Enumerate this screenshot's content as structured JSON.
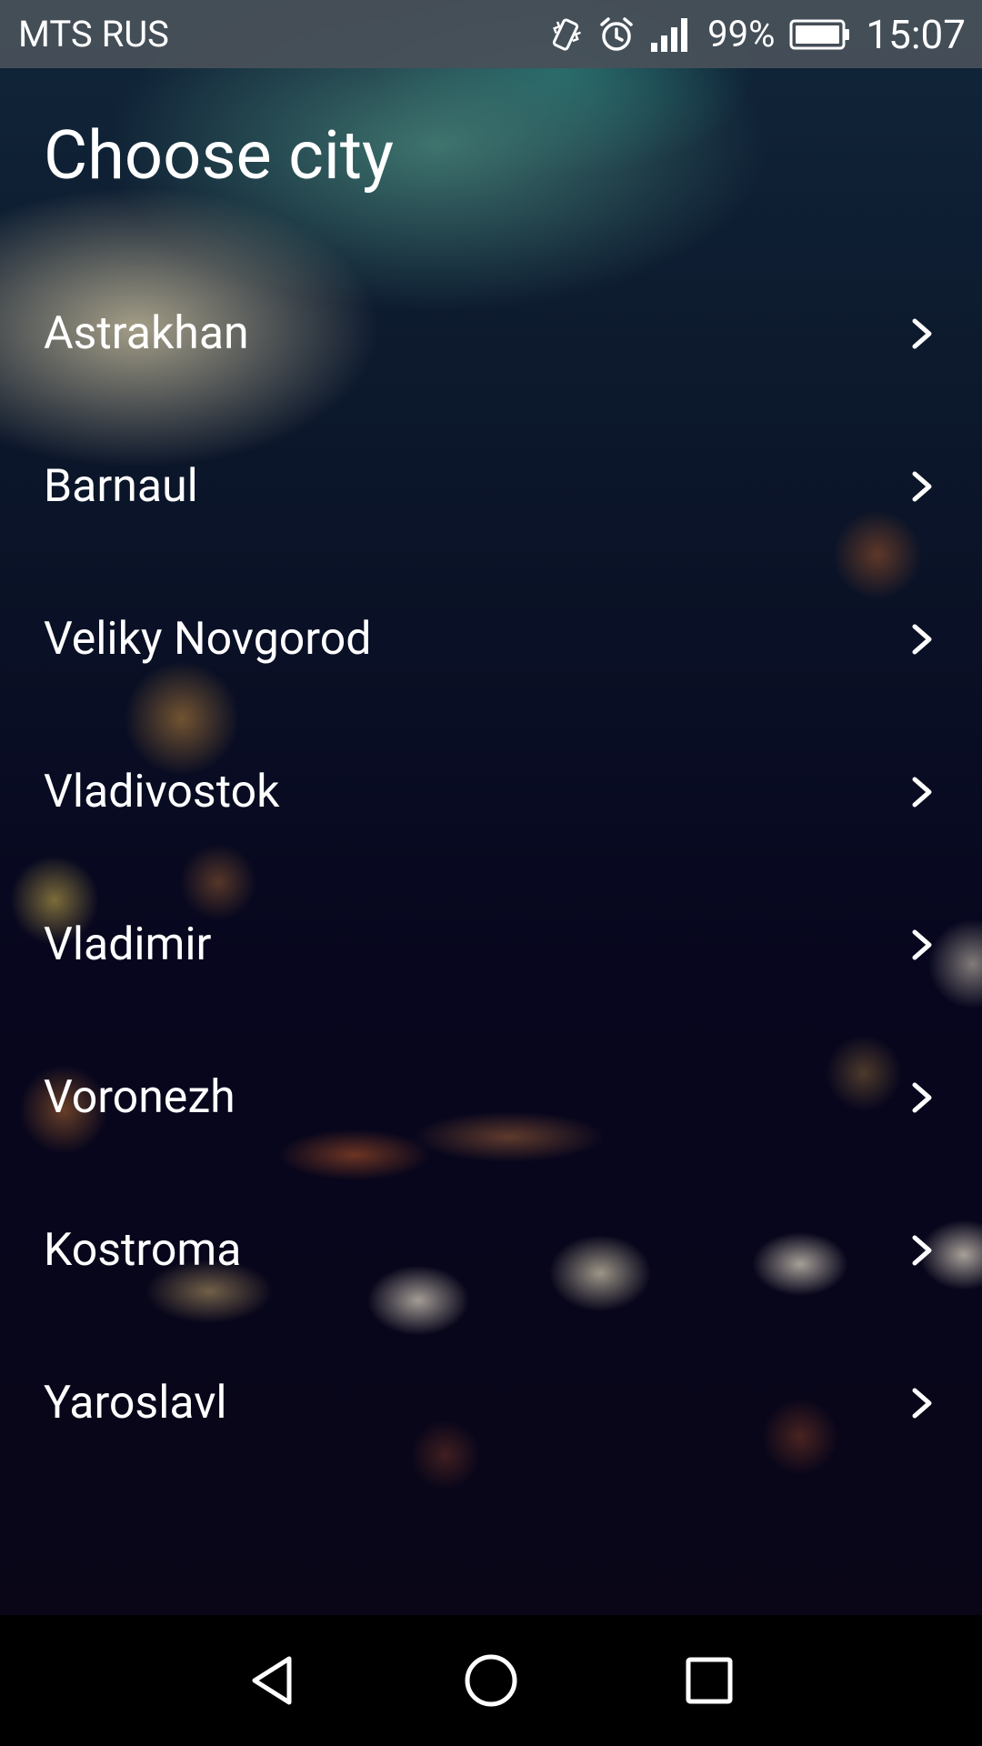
{
  "status_bar": {
    "carrier": "MTS RUS",
    "battery": "99%",
    "time": "15:07"
  },
  "page": {
    "title": "Choose city"
  },
  "cities": [
    {
      "label": "Astrakhan"
    },
    {
      "label": "Barnaul"
    },
    {
      "label": "Veliky Novgorod"
    },
    {
      "label": "Vladivostok"
    },
    {
      "label": "Vladimir"
    },
    {
      "label": "Voronezh"
    },
    {
      "label": "Kostroma"
    },
    {
      "label": "Yaroslavl"
    }
  ],
  "icons": {
    "list_item_icon": "chevron-right-icon",
    "status": [
      "vibrate-icon",
      "alarm-icon",
      "signal-icon",
      "battery-icon"
    ],
    "nav": [
      "back-icon",
      "home-icon",
      "recent-apps-icon"
    ]
  },
  "colors": {
    "status_bar_bg": "#485058",
    "text": "#ffffff",
    "nav_bar_bg": "#000000"
  }
}
